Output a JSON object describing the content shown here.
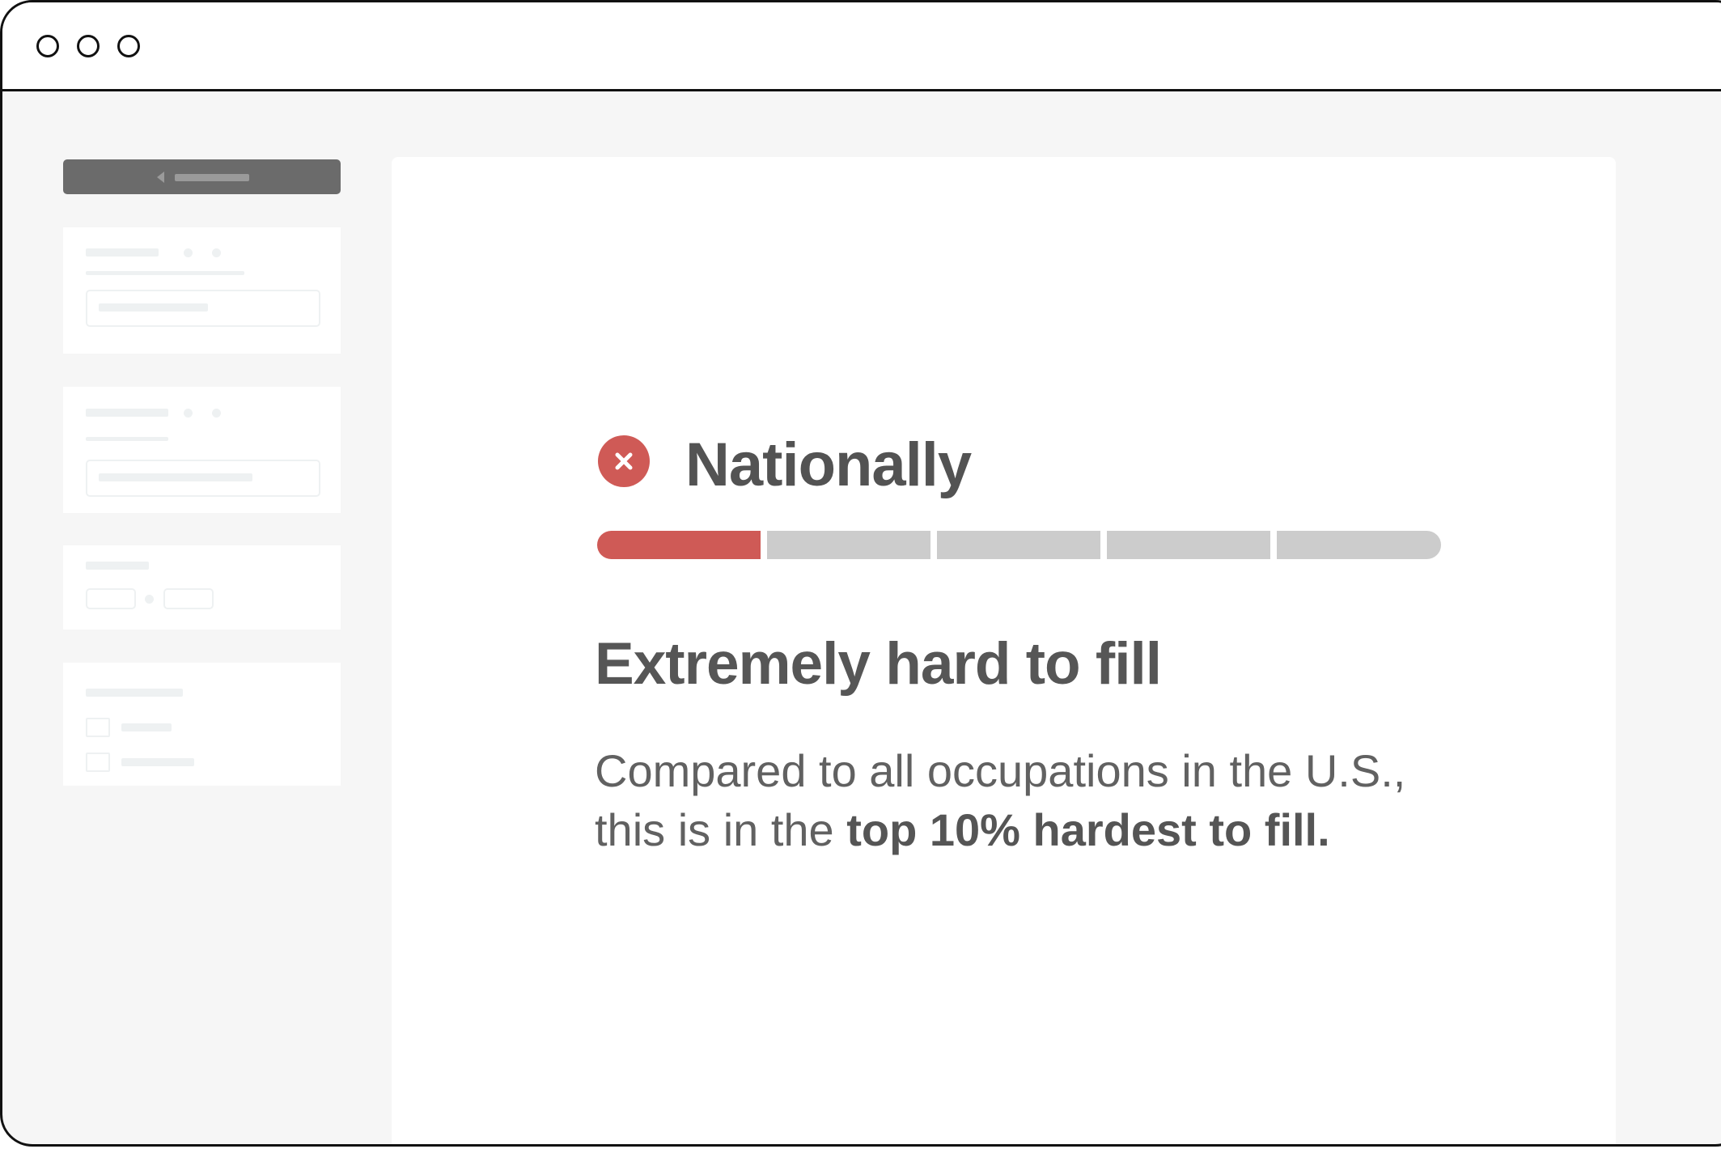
{
  "window": {
    "controls": [
      "close",
      "minimize",
      "maximize"
    ]
  },
  "main": {
    "status_icon": "x-circle-icon",
    "region_title": "Nationally",
    "difficulty_level": 1,
    "difficulty_scale": 5,
    "rating_label": "Extremely hard to fill",
    "description_pre": "Compared to all occupations in the U.S., this is in the ",
    "description_bold": "top 10% hardest to fill."
  },
  "colors": {
    "accent": "#cf5a56",
    "meter_inactive": "#cccccc",
    "background": "#f6f6f6"
  }
}
